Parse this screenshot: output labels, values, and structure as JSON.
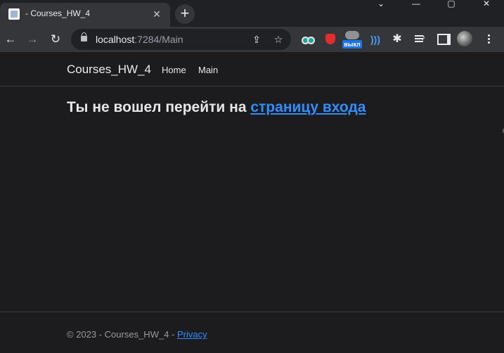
{
  "browser": {
    "tab_title": "- Courses_HW_4",
    "url_host": "localhost",
    "url_rest": ":7284/Main",
    "ext_vpn_badge": "выкл"
  },
  "site": {
    "brand": "Courses_HW_4",
    "nav": [
      "Home",
      "Main"
    ]
  },
  "main": {
    "message": "Ты не вошел перейти на ",
    "link_text": "страницу входа"
  },
  "footer": {
    "text": "© 2023 - Courses_HW_4 - ",
    "link": "Privacy"
  },
  "colors": {
    "page_bg": "#1c1c1e",
    "link": "#2f8dff"
  }
}
